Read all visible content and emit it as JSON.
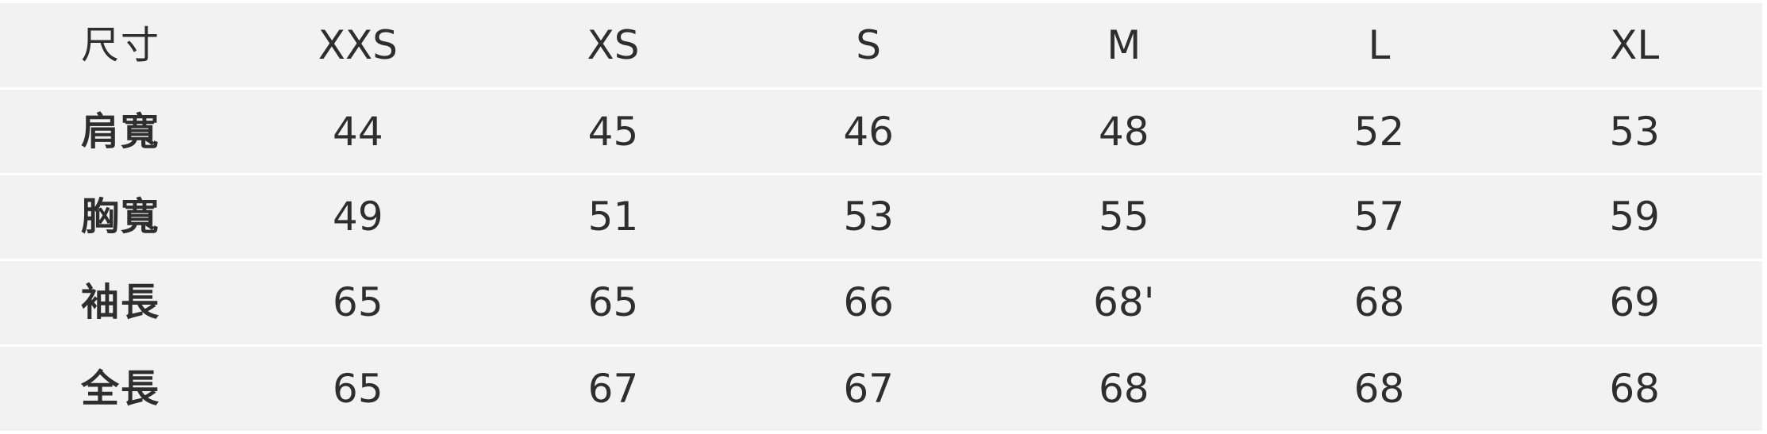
{
  "table": {
    "headers": [
      "尺寸",
      "XXS",
      "XS",
      "S",
      "M",
      "L",
      "XL"
    ],
    "rows": [
      {
        "label": "肩寬",
        "values": [
          "44",
          "45",
          "46",
          "48",
          "52",
          "53"
        ]
      },
      {
        "label": "胸寬",
        "values": [
          "49",
          "51",
          "53",
          "55",
          "57",
          "59"
        ]
      },
      {
        "label": "袖長",
        "values": [
          "65",
          "65",
          "66",
          "68'",
          "68",
          "69"
        ]
      },
      {
        "label": "全長",
        "values": [
          "65",
          "67",
          "67",
          "68",
          "68",
          "68"
        ]
      }
    ]
  }
}
